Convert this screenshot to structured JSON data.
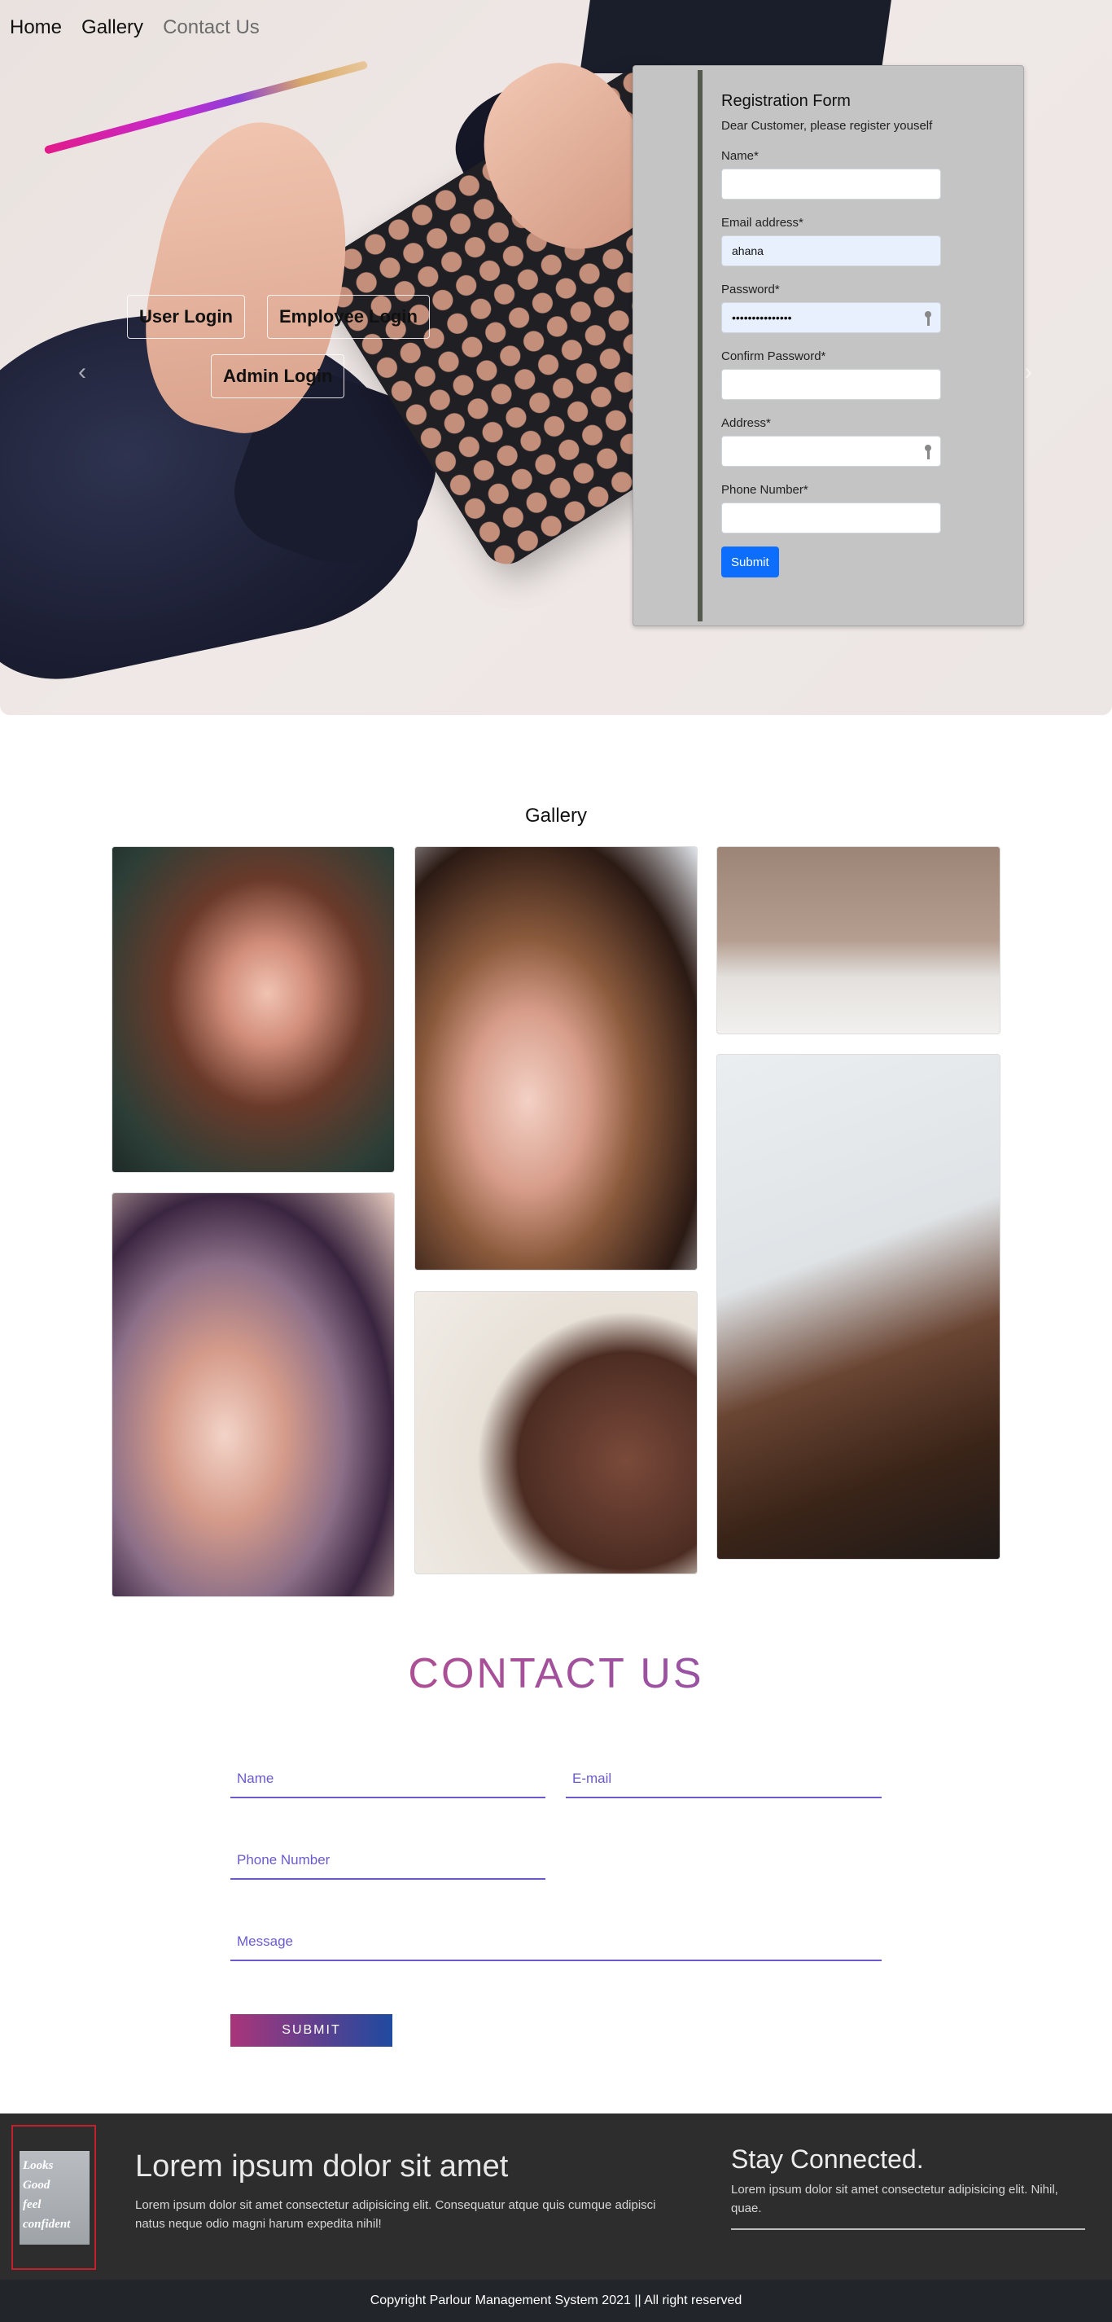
{
  "nav": {
    "home": "Home",
    "gallery": "Gallery",
    "contact": "Contact Us"
  },
  "hero": {
    "user_login": "User Login",
    "employee_login": "Employee Login",
    "admin_login": "Admin Login",
    "prev_arrow": "‹",
    "next_arrow": "›"
  },
  "registration": {
    "title": "Registration Form",
    "subtitle": "Dear Customer, please register youself",
    "name_label": "Name*",
    "name_value": "",
    "email_label": "Email address*",
    "email_value": "ahana",
    "password_label": "Password*",
    "password_value": "•••••••••••••••",
    "confirm_label": "Confirm Password*",
    "confirm_value": "",
    "address_label": "Address*",
    "address_value": "",
    "phone_label": "Phone Number*",
    "phone_value": "",
    "submit_label": "Submit"
  },
  "gallery": {
    "title": "Gallery"
  },
  "contact": {
    "title": "CONTACT US",
    "name_placeholder": "Name",
    "email_placeholder": "E-mail",
    "phone_placeholder": "Phone Number",
    "message_placeholder": "Message",
    "submit_label": "SUBMIT"
  },
  "footer": {
    "logo_lines": [
      "Looks",
      "Good",
      "feel",
      "confident"
    ],
    "heading": "Lorem ipsum dolor sit amet",
    "text": "Lorem ipsum dolor sit amet consectetur adipisicing elit. Consequatur atque quis cumque adipisci natus neque odio magni harum expedita nihil!",
    "stay_heading": "Stay Connected.",
    "stay_text": "Lorem ipsum dolor sit amet consectetur adipisicing elit. Nihil, quae.",
    "copyright": "Copyright Parlour Management System 2021 || All right reserved"
  },
  "colors": {
    "accent_blue": "#0d6efd",
    "contact_gradient_start": "#c94b7e",
    "contact_gradient_end": "#7c56b8",
    "footer_bg": "#2d2d2d"
  }
}
